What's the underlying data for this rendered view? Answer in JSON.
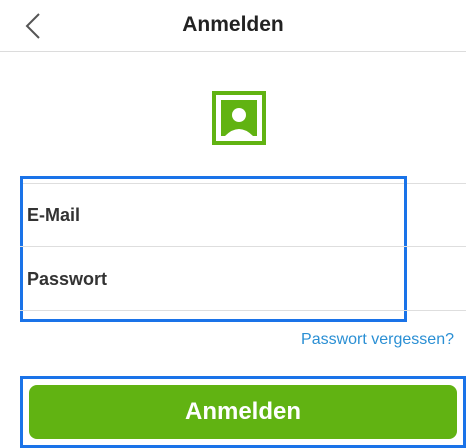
{
  "header": {
    "title": "Anmelden",
    "back_icon": "chevron-left-icon"
  },
  "avatar": {
    "icon": "user-photo-icon",
    "color": "#61b312"
  },
  "form": {
    "email_placeholder": "E-Mail",
    "password_placeholder": "Passwort",
    "forgot_label": "Passwort vergessen?"
  },
  "actions": {
    "login_label": "Anmelden",
    "button_color": "#61b312",
    "link_color": "#2a8fd4",
    "highlight_color": "#1a73e8"
  }
}
